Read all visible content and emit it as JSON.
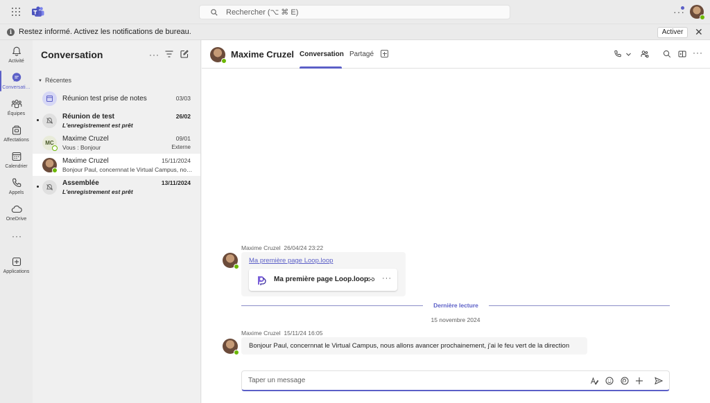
{
  "search": {
    "placeholder": "Rechercher (⌥ ⌘ E)"
  },
  "banner": {
    "text": "Restez informé. Activez les notifications de bureau.",
    "button": "Activer"
  },
  "rail": [
    {
      "label": "Activité",
      "icon": "bell-icon"
    },
    {
      "label": "Conversati…",
      "icon": "chat-icon"
    },
    {
      "label": "Équipes",
      "icon": "teams-icon"
    },
    {
      "label": "Affectations",
      "icon": "assignments-icon"
    },
    {
      "label": "Calendrier",
      "icon": "calendar-icon"
    },
    {
      "label": "Appels",
      "icon": "phone-icon"
    },
    {
      "label": "OneDrive",
      "icon": "cloud-icon"
    },
    {
      "label": "Applications",
      "icon": "add-apps-icon"
    }
  ],
  "list": {
    "title": "Conversation",
    "section": "Récentes",
    "chats": [
      {
        "name": "Réunion test prise de notes",
        "preview": "",
        "date": "03/03",
        "tag": "",
        "unread": false,
        "bold": false
      },
      {
        "name": "Réunion de test",
        "preview": "L'enregistrement est prêt",
        "date": "26/02",
        "tag": "",
        "unread": true,
        "bold": true
      },
      {
        "name": "Maxime Cruzel",
        "preview": "Vous : Bonjour",
        "date": "09/01",
        "tag": "Externe",
        "unread": false,
        "bold": false,
        "initials": "MC"
      },
      {
        "name": "Maxime Cruzel",
        "preview": "Bonjour Paul, concernnat le Virtual Campus, nous allons avancer prochainement",
        "date": "15/11/2024",
        "tag": "",
        "unread": false,
        "bold": false
      },
      {
        "name": "Assemblée",
        "preview": "L'enregistrement est prêt",
        "date": "13/11/2024",
        "tag": "",
        "unread": true,
        "bold": true
      }
    ]
  },
  "header": {
    "name": "Maxime Cruzel",
    "tabs": [
      "Conversation",
      "Partagé"
    ]
  },
  "messages": [
    {
      "author": "Maxime Cruzel",
      "time": "26/04/24 23:22",
      "link": "Ma première page Loop.loop",
      "card_title": "Ma première page Loop.loop"
    },
    {
      "author": "Maxime Cruzel",
      "time": "15/11/24 16:05",
      "text": "Bonjour Paul, concernnat le Virtual Campus, nous allons avancer prochainement, j'ai le feu vert de la direction"
    }
  ],
  "divider": {
    "label": "Dernière lecture",
    "date": "15 novembre 2024"
  },
  "compose": {
    "placeholder": "Taper un message"
  },
  "colors": {
    "accent": "#5b5fc7",
    "presence": "#6bb700"
  }
}
